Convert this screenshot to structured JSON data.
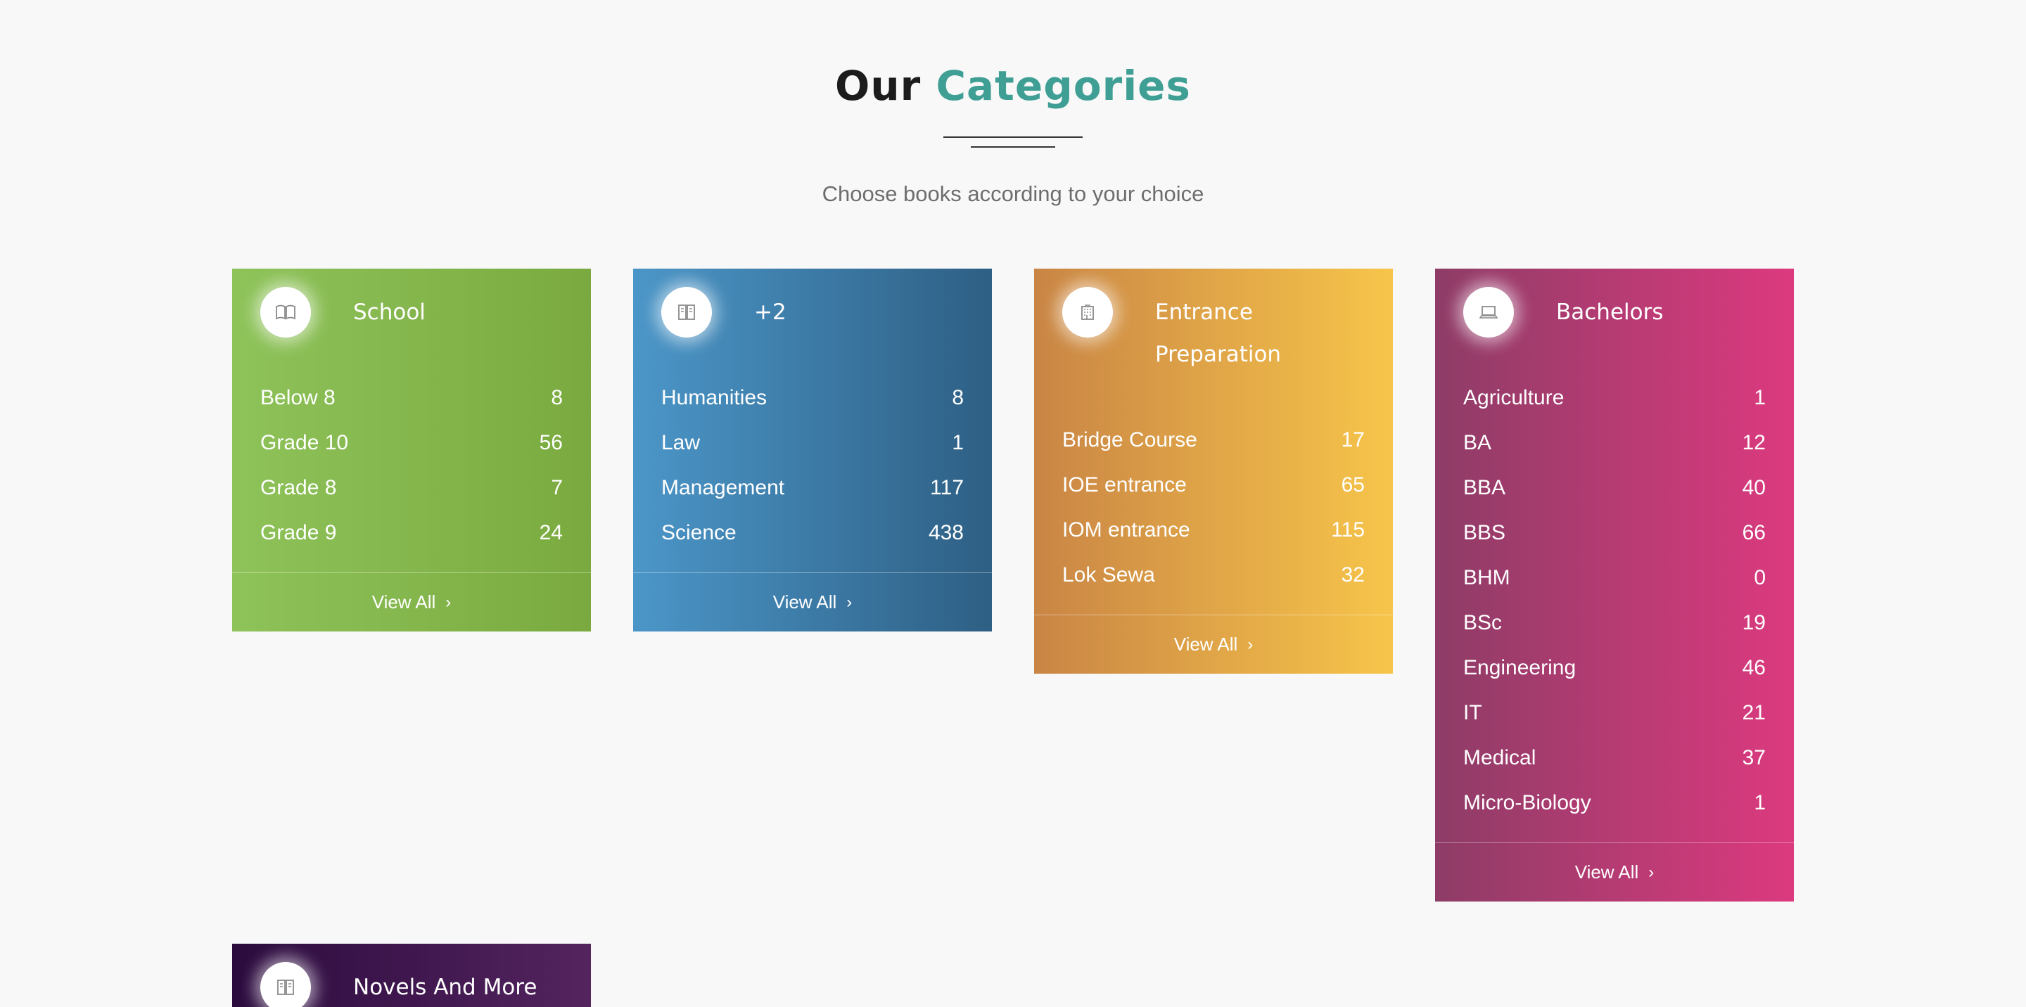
{
  "section": {
    "title_prefix": "Our",
    "title_accent": "Categories",
    "subtitle": "Choose books according to your choice"
  },
  "colors": {
    "accent": "#3f9f94",
    "school": "#86b84e",
    "plus2": "#3d7fb0",
    "entrance": "#e0a447",
    "bachelors": "#b93a74",
    "novels": "#3d1650"
  },
  "cards": [
    {
      "title": "School",
      "icon": "open-book-icon",
      "view_all": "View All",
      "items": [
        {
          "label": "Below 8",
          "count": "8"
        },
        {
          "label": "Grade 10",
          "count": "56"
        },
        {
          "label": "Grade 8",
          "count": "7"
        },
        {
          "label": "Grade 9",
          "count": "24"
        }
      ]
    },
    {
      "title": "+2",
      "icon": "book-icon",
      "view_all": "View All",
      "items": [
        {
          "label": "Humanities",
          "count": "8"
        },
        {
          "label": "Law",
          "count": "1"
        },
        {
          "label": "Management",
          "count": "117"
        },
        {
          "label": "Science",
          "count": "438"
        }
      ]
    },
    {
      "title": "Entrance Preparation",
      "icon": "building-icon",
      "view_all": "View All",
      "items": [
        {
          "label": "Bridge Course",
          "count": "17"
        },
        {
          "label": "IOE entrance",
          "count": "65"
        },
        {
          "label": "IOM entrance",
          "count": "115"
        },
        {
          "label": "Lok Sewa",
          "count": "32"
        }
      ]
    },
    {
      "title": "Bachelors",
      "icon": "laptop-icon",
      "view_all": "View All",
      "items": [
        {
          "label": "Agriculture",
          "count": "1"
        },
        {
          "label": "BA",
          "count": "12"
        },
        {
          "label": "BBA",
          "count": "40"
        },
        {
          "label": "BBS",
          "count": "66"
        },
        {
          "label": "BHM",
          "count": "0"
        },
        {
          "label": "BSc",
          "count": "19"
        },
        {
          "label": "Engineering",
          "count": "46"
        },
        {
          "label": "IT",
          "count": "21"
        },
        {
          "label": "Medical",
          "count": "37"
        },
        {
          "label": "Micro-Biology",
          "count": "1"
        }
      ]
    },
    {
      "title": "Novels And More",
      "icon": "book-icon"
    }
  ]
}
